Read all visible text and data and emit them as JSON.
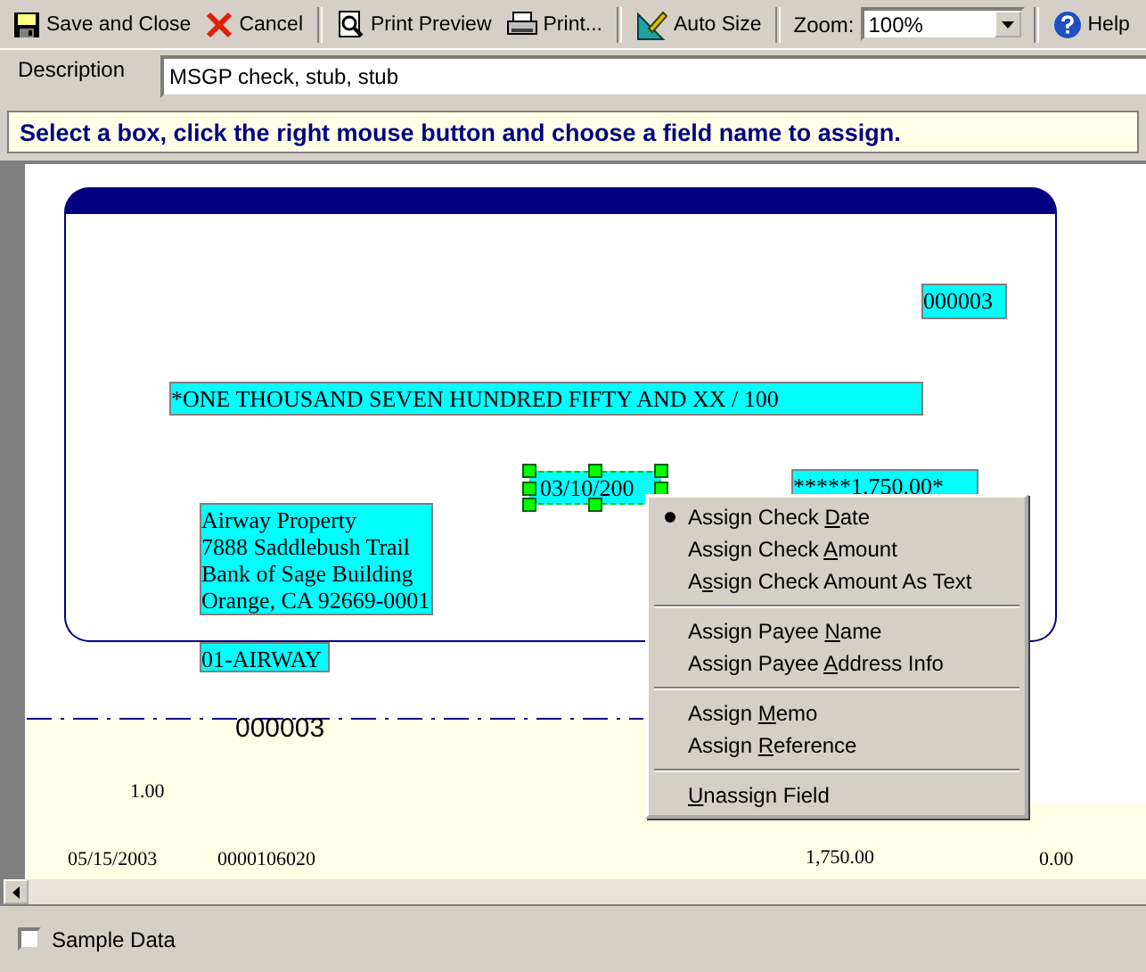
{
  "toolbar": {
    "buttons": [
      {
        "label": "Save and Close"
      },
      {
        "label": "Cancel"
      },
      {
        "label": "Print Preview"
      },
      {
        "label": "Print..."
      },
      {
        "label": "Auto Size"
      }
    ],
    "zoom": {
      "label": "Zoom:",
      "value": "100%"
    },
    "help": {
      "label": "Help"
    }
  },
  "description": {
    "label": "Description",
    "value": "MSGP check, stub, stub"
  },
  "instruction": "Select a box, click the right mouse button and choose a field name to assign.",
  "canvas": {
    "fields": [
      {
        "lines": [
          "000003"
        ],
        "selected": false
      },
      {
        "lines": [
          "*ONE THOUSAND SEVEN HUNDRED FIFTY AND XX / 100"
        ],
        "selected": false
      },
      {
        "lines": [
          "03/10/200"
        ],
        "selected": true
      },
      {
        "lines": [
          "*****1,750.00*"
        ],
        "selected": false
      },
      {
        "lines": [
          "Airway Property",
          "7888 Saddlebush Trail",
          "Bank of Sage Building",
          "Orange, CA 92669-0001"
        ],
        "selected": false
      },
      {
        "lines": [
          "01-AIRWAY"
        ],
        "selected": false
      }
    ],
    "stub_texts": [
      "000003",
      "1.00",
      "05/15/2003",
      "0000106020",
      "1,750.00",
      "0.00"
    ]
  },
  "context_menu": {
    "groups": [
      [
        {
          "start": "Assign Check ",
          "accel": "D",
          "rest": "ate",
          "checked": true
        },
        {
          "start": "Assign Check ",
          "accel": "A",
          "rest": "mount",
          "checked": false
        },
        {
          "start": "A",
          "accel": "s",
          "rest": "sign Check Amount As Text",
          "checked": false
        }
      ],
      [
        {
          "start": "Assign Payee ",
          "accel": "N",
          "rest": "ame",
          "checked": false
        },
        {
          "start": "Assign Payee ",
          "accel": "A",
          "rest": "ddress Info",
          "checked": false
        }
      ],
      [
        {
          "start": "Assign ",
          "accel": "M",
          "rest": "emo",
          "checked": false
        },
        {
          "start": "Assign ",
          "accel": "R",
          "rest": "eference",
          "checked": false
        }
      ],
      [
        {
          "accel": "U",
          "rest": "nassign Field",
          "checked": false
        }
      ]
    ]
  },
  "sample_data": {
    "label": "Sample Data",
    "checked": false
  }
}
